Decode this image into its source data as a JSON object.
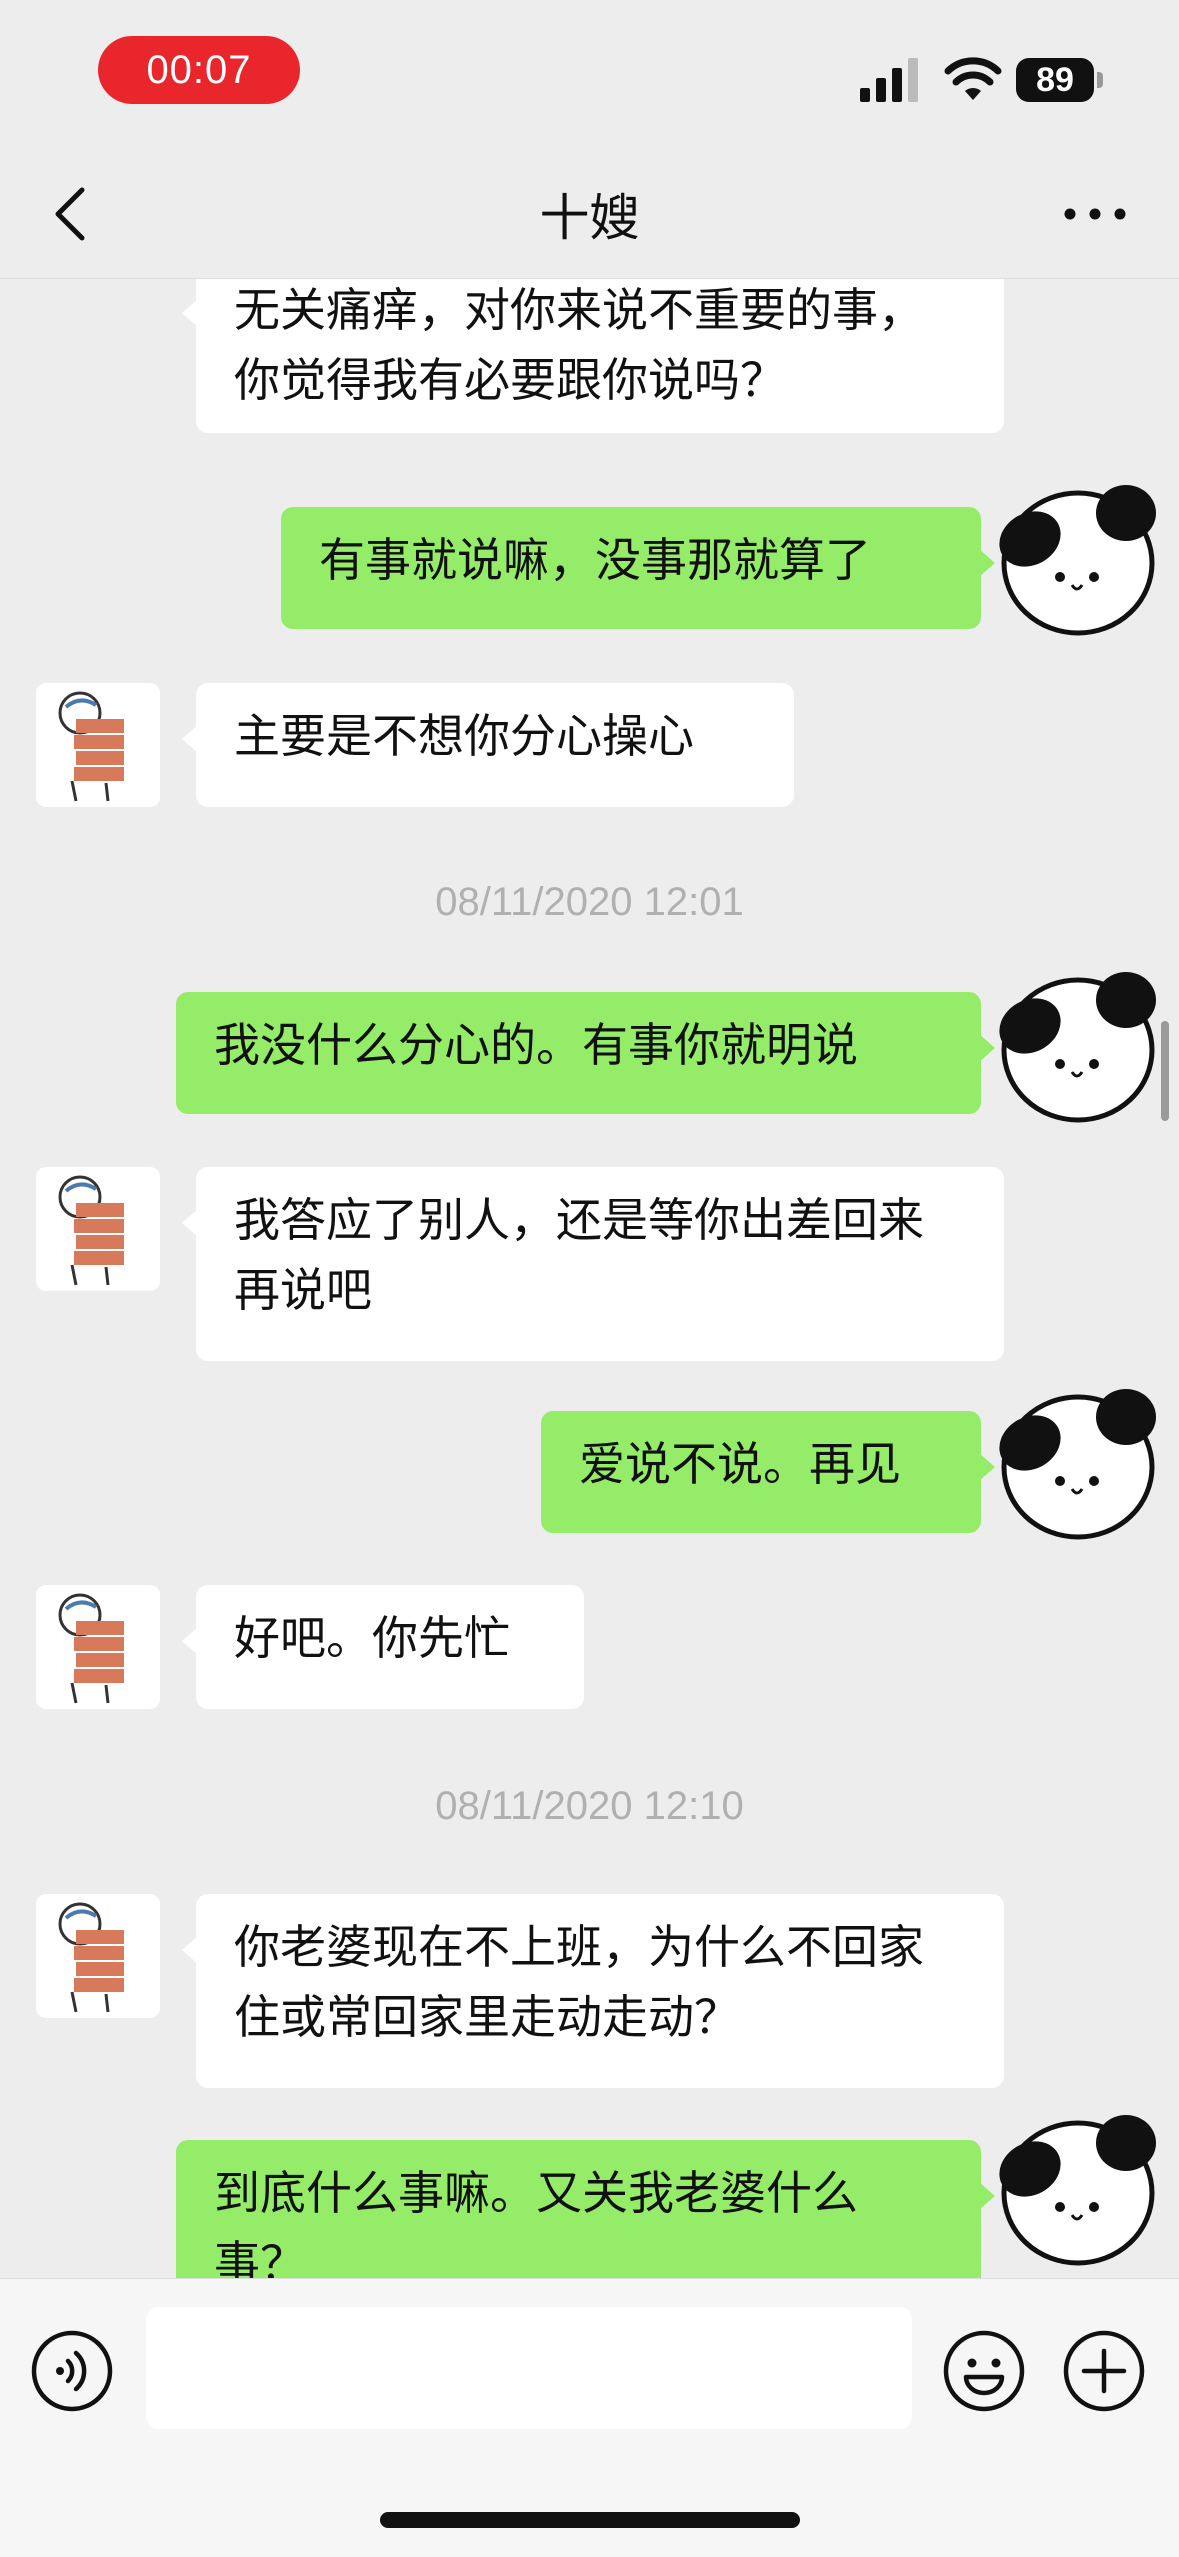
{
  "status_bar": {
    "recording_time": "00:07",
    "battery": "89"
  },
  "nav": {
    "title": "十嫂"
  },
  "colors": {
    "bubble_out": "#95ec69",
    "bubble_in": "#ffffff",
    "background": "#ededed",
    "recording": "#e8262c"
  },
  "messages": [
    {
      "side": "in",
      "text": "无关痛痒，对你来说不重要的事，你觉得我有必要跟你说吗？"
    },
    {
      "side": "out",
      "text": "有事就说嘛，没事那就算了"
    },
    {
      "side": "in",
      "text": "主要是不想你分心操心"
    },
    {
      "timestamp": "08/11/2020 12:01"
    },
    {
      "side": "out",
      "text": "我没什么分心的。有事你就明说"
    },
    {
      "side": "in",
      "text": "我答应了别人，还是等你出差回来再说吧"
    },
    {
      "side": "out",
      "text": "爱说不说。再见"
    },
    {
      "side": "in",
      "text": "好吧。你先忙"
    },
    {
      "timestamp": "08/11/2020 12:10"
    },
    {
      "side": "in",
      "text": "你老婆现在不上班，为什么不回家住或常回家里走动走动？"
    },
    {
      "side": "out",
      "text": "到底什么事嘛。又关我老婆什么事？"
    }
  ],
  "input": {
    "placeholder": ""
  },
  "icons": {
    "back": "chevron-left-icon",
    "more": "more-dots-icon",
    "voice": "voice-icon",
    "emoji": "emoji-icon",
    "plus": "plus-icon"
  }
}
